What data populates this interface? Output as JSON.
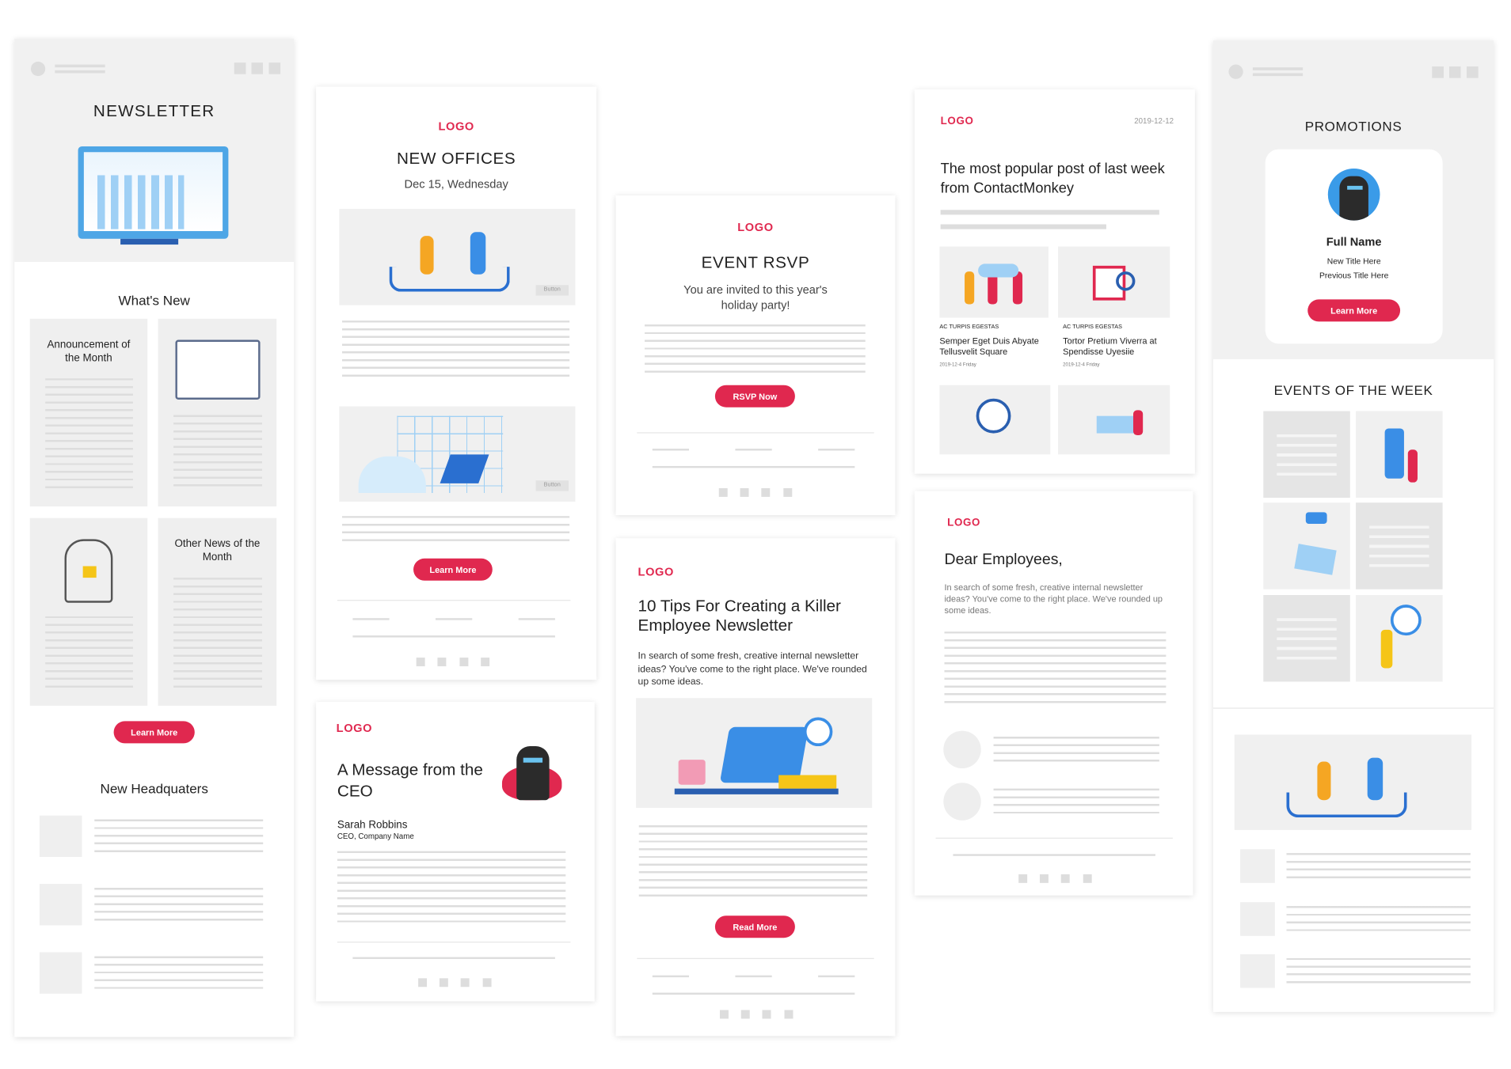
{
  "colors": {
    "accent": "#e0284f",
    "panel": "#efefef"
  },
  "newsletter": {
    "title": "NEWSLETTER",
    "whats_new": "What's New",
    "box1": "Announcement of the Month",
    "box2": "Other News of the Month",
    "button": "Learn More",
    "hq": "New Headquaters"
  },
  "offices": {
    "logo": "LOGO",
    "title": "NEW OFFICES",
    "date": "Dec 15, Wednesday",
    "img_button": "Button",
    "button": "Learn More"
  },
  "ceo": {
    "logo": "LOGO",
    "title": "A Message from the CEO",
    "name": "Sarah Robbins",
    "role": "CEO, Company Name"
  },
  "rsvp": {
    "logo": "LOGO",
    "title": "EVENT RSVP",
    "text": "You are invited to this year's holiday party!",
    "button": "RSVP Now"
  },
  "tips": {
    "logo": "LOGO",
    "title": "10 Tips For Creating a Killer Employee Newsletter",
    "text": "In search of some fresh, creative internal newsletter ideas? You've come to the right place. We've rounded up some ideas.",
    "button": "Read More"
  },
  "popular": {
    "logo": "LOGO",
    "date": "2019-12-12",
    "title": "The most popular post of last week from ContactMonkey",
    "posts": [
      {
        "tag": "AC TURPIS EGESTAS",
        "title": "Semper Eget Duis Abyate Tellusvelit Square",
        "date": "2019-12-4 Friday"
      },
      {
        "tag": "AC TURPIS EGESTAS",
        "title": "Tortor Pretium Viverra at Spendisse Uyesiie",
        "date": "2019-12-4 Friday"
      }
    ]
  },
  "dear": {
    "logo": "LOGO",
    "title": "Dear Employees,",
    "text": "In search of some fresh, creative internal newsletter ideas? You've come to the right place. We've rounded up some ideas."
  },
  "promotions": {
    "title": "PROMOTIONS",
    "name": "Full Name",
    "new_title": "New Title Here",
    "prev_title": "Previous Title Here",
    "button": "Learn More",
    "events": "EVENTS OF THE WEEK"
  }
}
